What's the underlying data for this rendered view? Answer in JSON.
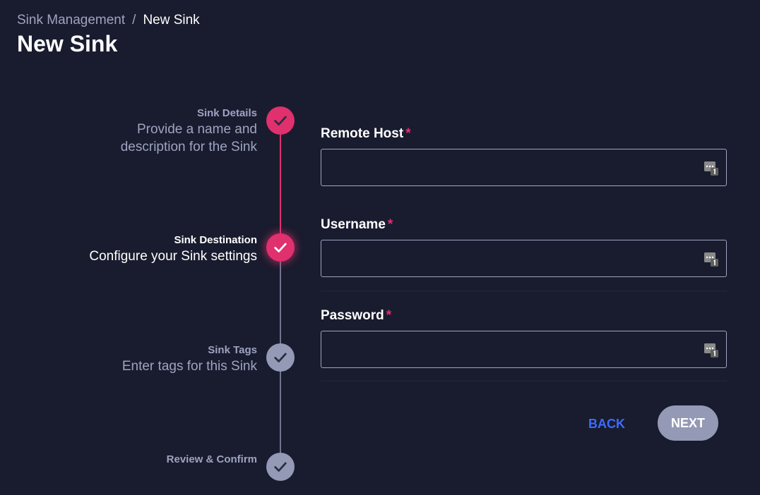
{
  "breadcrumb": {
    "parent": "Sink Management",
    "separator": "/",
    "current": "New Sink"
  },
  "page_title": "New Sink",
  "stepper": {
    "steps": [
      {
        "title": "Sink Details",
        "description": "Provide a name and description for the Sink",
        "description_lines": [
          "Provide a name and",
          "description for the Sink"
        ],
        "state": "done"
      },
      {
        "title": "Sink Destination",
        "description": "Configure your Sink settings",
        "state": "active"
      },
      {
        "title": "Sink Tags",
        "description": "Enter tags for this Sink",
        "state": "pending"
      },
      {
        "title": "Review & Confirm",
        "description": "",
        "state": "pending"
      }
    ]
  },
  "form": {
    "fields": [
      {
        "label": "Remote Host",
        "required_mark": "*",
        "value": "",
        "icon": "password-manager-icon"
      },
      {
        "label": "Username",
        "required_mark": "*",
        "value": "",
        "icon": "password-manager-icon"
      },
      {
        "label": "Password",
        "required_mark": "*",
        "value": "",
        "icon": "password-manager-icon"
      }
    ]
  },
  "actions": {
    "back_label": "BACK",
    "next_label": "NEXT"
  },
  "colors": {
    "background": "#191c2e",
    "accent": "#e0306e",
    "pending": "#9499b5",
    "link": "#3d6bff",
    "muted_text": "#9ea3c2"
  }
}
